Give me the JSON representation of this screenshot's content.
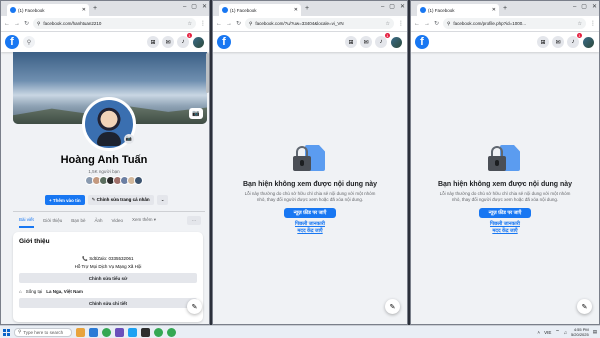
{
  "window1": {
    "tab_title": "(1) Facebook",
    "url": "facebook.com/hanhtuan2210",
    "profile": {
      "name": "Hoàng Anh Tuấn",
      "friends": "1,5K người bạn",
      "add_story": "+ Thêm vào tin",
      "edit_profile": "✎ Chỉnh sửa trang cá nhân",
      "tabs": [
        "Bài viết",
        "Giới thiệu",
        "Bạn bè",
        "Ảnh",
        "Video",
        "Xem thêm ▾"
      ],
      "intro_title": "Giới thiệu",
      "bio_line1": "📞 Sdt/Zalo: 0335532061",
      "bio_line2": "Hỗ Trợ Mọi Dịch Vụ Mạng Xã Hội",
      "edit_bio": "Chỉnh sửa tiểu sử",
      "lives_in_prefix": "Sống tại",
      "lives_in_place": "La Nga, Việt Nam",
      "edit_details": "Chỉnh sửa chi tiết"
    }
  },
  "window2": {
    "tab_title": "(1) Facebook",
    "url": "facebook.com/?u/?uw=33404&locale=vi_VN"
  },
  "window3": {
    "tab_title": "(1) Facebook",
    "url": "facebook.com/profile.php?id=1000..."
  },
  "unavailable": {
    "title": "Bạn hiện không xem được nội dung này",
    "desc": "Lỗi này thường do chủ sở hữu chỉ chia sẻ nội dung với một nhóm nhỏ, thay đổi người được xem hoặc đã xóa nội dung.",
    "button": "न्यूज़ फ़ीड पर जाएँ",
    "link1": "पिछली जानकारी",
    "link2": "मदद केंद्र जाएँ"
  },
  "fb_badge": "1",
  "taskbar": {
    "search_placeholder": "Type here to search",
    "time": "4:55 PM",
    "date": "5/20/2025",
    "lang": "VIE"
  },
  "colors": {
    "fb_blue": "#1877f2",
    "page_bg": "#f0f2f5",
    "notif_red": "#e41e3f"
  },
  "icons": [
    "search-icon",
    "grid-icon",
    "messenger-icon",
    "bell-icon",
    "camera-icon",
    "compose-icon",
    "lock-icon",
    "windows-logo-icon"
  ]
}
